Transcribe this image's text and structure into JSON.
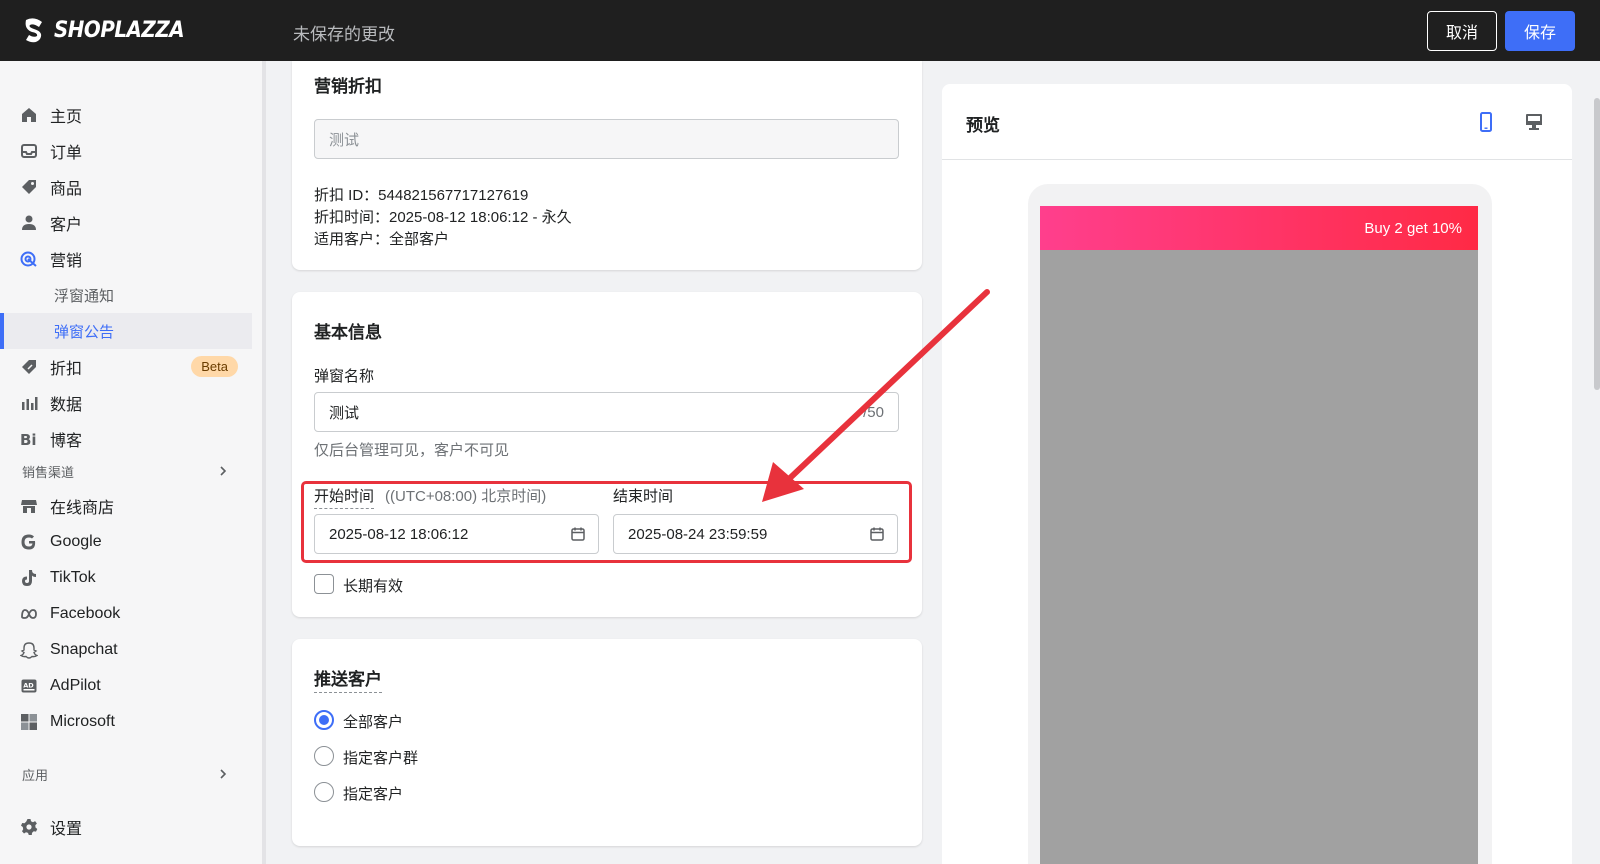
{
  "topbar": {
    "logo_text": "SHOPLAZZA",
    "status": "未保存的更改",
    "cancel_label": "取消",
    "save_label": "保存"
  },
  "sidebar": {
    "items": [
      {
        "label": "主页",
        "icon": "home-icon"
      },
      {
        "label": "订单",
        "icon": "inbox-icon"
      },
      {
        "label": "商品",
        "icon": "tag-icon"
      },
      {
        "label": "客户",
        "icon": "person-icon"
      },
      {
        "label": "营销",
        "icon": "target-icon"
      },
      {
        "label": "浮窗通知"
      },
      {
        "label": "弹窗公告"
      },
      {
        "label": "折扣",
        "icon": "discount-icon",
        "badge": "Beta"
      },
      {
        "label": "数据",
        "icon": "bar-chart-icon"
      },
      {
        "label": "博客",
        "icon": "blog-icon"
      }
    ],
    "sales_channels_label": "销售渠道",
    "channels": [
      {
        "label": "在线商店",
        "icon": "store-icon"
      },
      {
        "label": "Google",
        "icon": "google-icon"
      },
      {
        "label": "TikTok",
        "icon": "tiktok-icon"
      },
      {
        "label": "Facebook",
        "icon": "meta-icon"
      },
      {
        "label": "Snapchat",
        "icon": "snapchat-icon"
      },
      {
        "label": "AdPilot",
        "icon": "adpilot-icon"
      },
      {
        "label": "Microsoft",
        "icon": "microsoft-icon"
      }
    ],
    "apps_label": "应用",
    "settings_label": "设置"
  },
  "discount_card": {
    "title": "营销折扣",
    "field_value": "测试",
    "discount_id": "折扣 ID：5448215677171276​19",
    "discount_time": "折扣时间：2025-08-12 18:06:12 - 永久",
    "applicable": "适用客户：全部客户"
  },
  "basic_info": {
    "title": "基本信息",
    "name_label": "弹窗名称",
    "name_value": "测试",
    "name_counter": "/50",
    "name_hint": "仅后台管理可见，客户不可见",
    "start_label": "开始时间",
    "timezone_hint": "((UTC+08:00) 北京时间)",
    "end_label": "结束时间",
    "start_value": "2025-08-12 18:06:12",
    "end_value": "2025-08-24 23:59:59",
    "long_term_label": "长期有效"
  },
  "push_customers": {
    "title": "推送客户",
    "options": [
      "全部客户",
      "指定客户群",
      "指定客户"
    ],
    "selected": "全部客户"
  },
  "preview": {
    "title": "预览",
    "banner_text": "Buy 2 get 10%"
  },
  "colors": {
    "accent": "#3e6ef7",
    "annotation": "#e8323c"
  }
}
